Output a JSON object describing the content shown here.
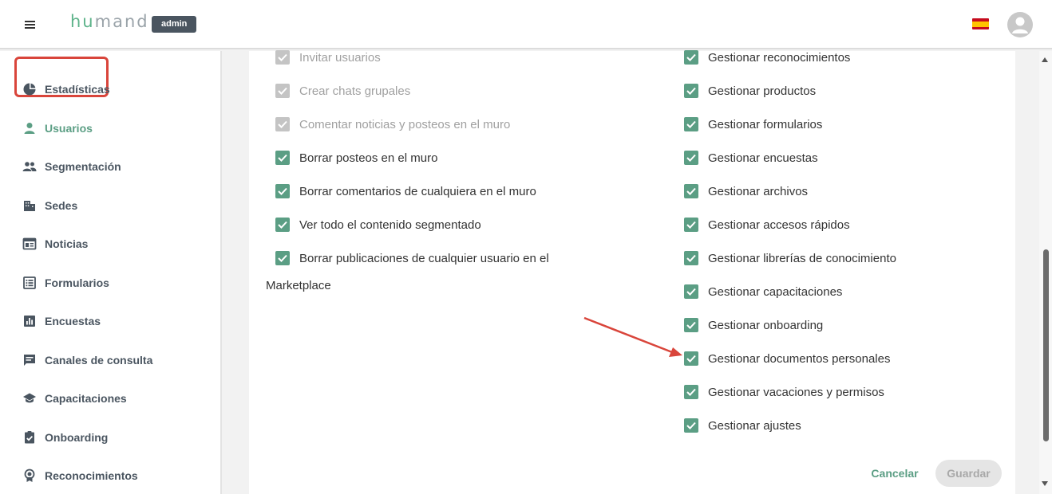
{
  "header": {
    "logo_part1": "hu",
    "logo_part2": "mand",
    "badge": "admin",
    "language_flag": "spain-flag-icon"
  },
  "sidebar": {
    "items": [
      {
        "label": "Estadísticas",
        "icon": "pie-chart-icon"
      },
      {
        "label": "Usuarios",
        "icon": "person-icon",
        "active": true
      },
      {
        "label": "Segmentación",
        "icon": "group-icon"
      },
      {
        "label": "Sedes",
        "icon": "building-icon"
      },
      {
        "label": "Noticias",
        "icon": "newspaper-icon"
      },
      {
        "label": "Formularios",
        "icon": "list-form-icon"
      },
      {
        "label": "Encuestas",
        "icon": "bar-chart-icon"
      },
      {
        "label": "Canales de consulta",
        "icon": "chat-icon"
      },
      {
        "label": "Capacitaciones",
        "icon": "school-icon"
      },
      {
        "label": "Onboarding",
        "icon": "clipboard-check-icon"
      },
      {
        "label": "Reconocimientos",
        "icon": "award-icon"
      }
    ]
  },
  "permissions": {
    "left": [
      {
        "label": "Invitar usuarios",
        "checked": true,
        "disabled": true
      },
      {
        "label": "Crear chats grupales",
        "checked": true,
        "disabled": true
      },
      {
        "label": "Comentar noticias y posteos en el muro",
        "checked": true,
        "disabled": true
      },
      {
        "label": "Borrar posteos en el muro",
        "checked": true,
        "disabled": false
      },
      {
        "label": "Borrar comentarios de cualquiera en el muro",
        "checked": true,
        "disabled": false
      },
      {
        "label": "Ver todo el contenido segmentado",
        "checked": true,
        "disabled": false
      },
      {
        "label": "Borrar publicaciones de cualquier usuario en el",
        "checked": true,
        "disabled": false
      }
    ],
    "left_wrap": "Marketplace",
    "right": [
      {
        "label": "Gestionar reconocimientos",
        "checked": true
      },
      {
        "label": "Gestionar productos",
        "checked": true
      },
      {
        "label": "Gestionar formularios",
        "checked": true
      },
      {
        "label": "Gestionar encuestas",
        "checked": true
      },
      {
        "label": "Gestionar archivos",
        "checked": true
      },
      {
        "label": "Gestionar accesos rápidos",
        "checked": true
      },
      {
        "label": "Gestionar librerías de conocimiento",
        "checked": true
      },
      {
        "label": "Gestionar capacitaciones",
        "checked": true
      },
      {
        "label": "Gestionar onboarding",
        "checked": true
      },
      {
        "label": "Gestionar documentos personales",
        "checked": true
      },
      {
        "label": "Gestionar vacaciones y permisos",
        "checked": true
      },
      {
        "label": "Gestionar ajustes",
        "checked": true
      }
    ]
  },
  "actions": {
    "cancel": "Cancelar",
    "save": "Guardar"
  },
  "colors": {
    "accent": "#5b9e84",
    "highlight": "#d9453b",
    "badge_bg": "#4a5560"
  }
}
